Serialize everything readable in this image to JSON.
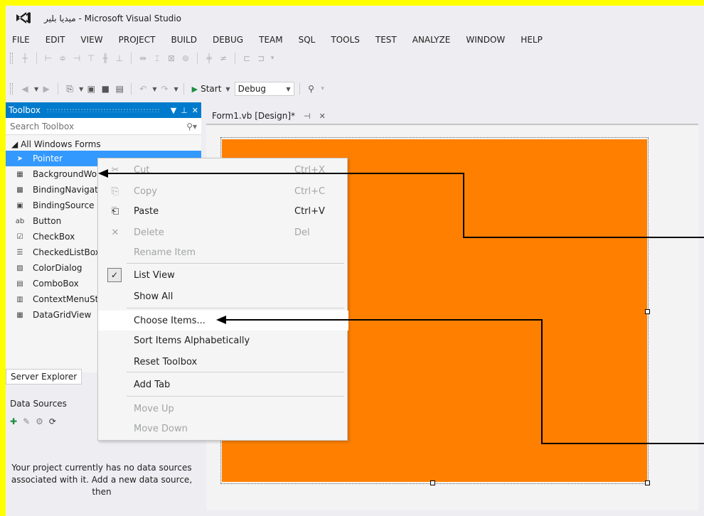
{
  "title": {
    "app_title": "ميديا بلير - Microsoft Visual Studio"
  },
  "menu": [
    "FILE",
    "EDIT",
    "VIEW",
    "PROJECT",
    "BUILD",
    "DEBUG",
    "TEAM",
    "SQL",
    "TOOLS",
    "TEST",
    "ANALYZE",
    "WINDOW",
    "HELP"
  ],
  "toolbar": {
    "start_label": "Start",
    "config_value": "Debug"
  },
  "toolbox": {
    "title": "Toolbox",
    "search_placeholder": "Search Toolbox",
    "group": "All Windows Forms",
    "items": [
      "Pointer",
      "BackgroundWorker",
      "BindingNavigator",
      "BindingSource",
      "Button",
      "CheckBox",
      "CheckedListBox",
      "ColorDialog",
      "ComboBox",
      "ContextMenuStrip",
      "DataGridView"
    ]
  },
  "server_explorer_tab": "Server Explorer",
  "data_sources": {
    "title": "Data Sources",
    "message": "Your project currently has no data sources associated with it. Add a new data source, then"
  },
  "document_tab": {
    "label": "Form1.vb [Design]*"
  },
  "form": {
    "backcolor": "#ff8000"
  },
  "context_menu": {
    "items": [
      {
        "label": "Cut",
        "shortcut": "Ctrl+X",
        "disabled": true
      },
      {
        "label": "Copy",
        "shortcut": "Ctrl+C",
        "disabled": true
      },
      {
        "label": "Paste",
        "shortcut": "Ctrl+V",
        "disabled": false
      },
      {
        "label": "Delete",
        "shortcut": "Del",
        "disabled": true
      },
      {
        "label": "Rename Item",
        "shortcut": "",
        "disabled": true
      },
      {
        "label": "List View",
        "shortcut": "",
        "disabled": false,
        "checked": true
      },
      {
        "label": "Show All",
        "shortcut": "",
        "disabled": false
      },
      {
        "label": "Choose Items...",
        "shortcut": "",
        "disabled": false,
        "highlighted": true
      },
      {
        "label": "Sort Items Alphabetically",
        "shortcut": "",
        "disabled": false
      },
      {
        "label": "Reset Toolbox",
        "shortcut": "",
        "disabled": false
      },
      {
        "label": "Add Tab",
        "shortcut": "",
        "disabled": false
      },
      {
        "label": "Move Up",
        "shortcut": "",
        "disabled": true
      },
      {
        "label": "Move Down",
        "shortcut": "",
        "disabled": true
      }
    ]
  },
  "colors": {
    "accent": "#007acc",
    "selection": "#3399ff",
    "border_highlight": "#ffff00"
  }
}
